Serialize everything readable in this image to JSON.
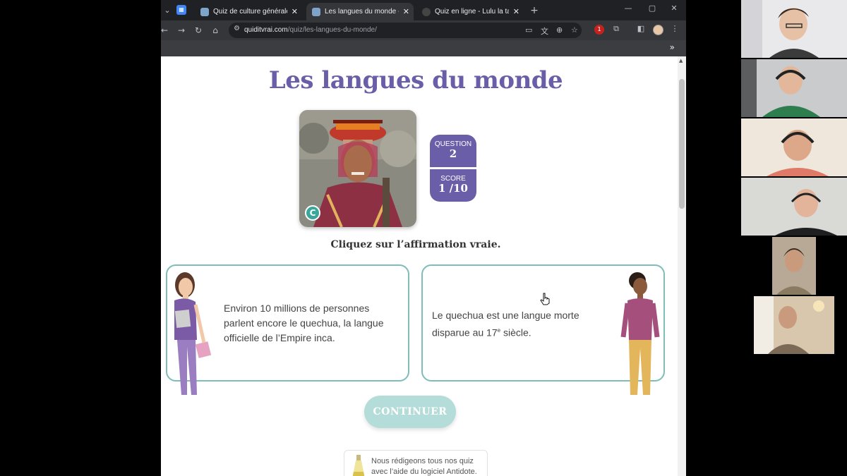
{
  "browser": {
    "tabs": [
      {
        "title": "Quiz de culture générale - Quiz",
        "active": false
      },
      {
        "title": "Les langues du monde - Quiz C",
        "active": true
      },
      {
        "title": "Quiz en ligne - Lulu la taupe, je",
        "active": false
      }
    ],
    "new_tab_symbol": "+",
    "url_domain": "quiditvrai.com",
    "url_path": "/quiz/les-langues-du-monde/",
    "bookmarks_overflow": "»",
    "extension_badge": "1"
  },
  "quiz": {
    "title": "Les langues du monde",
    "photo_badge": "C",
    "question_label": "QUESTION",
    "question_number": "2",
    "score_label": "SCORE",
    "score_value": "1 /10",
    "instruction": "Cliquez sur l’affirmation vraie.",
    "answers": [
      {
        "text": "Environ 10 millions de personnes parlent encore le quechua, la langue officielle de l’Empire inca."
      },
      {
        "text_before": "Le quechua est une langue morte disparue au 17",
        "superscript": "e",
        "text_after": " siècle."
      }
    ],
    "continue_label": "CONTINUER",
    "antidote_text": "Nous rédigeons tous nos quiz avec l’aide du logiciel Antidote."
  },
  "colors": {
    "brand_purple": "#6b5ea8",
    "teal_border": "#7fbdb8",
    "continue_bg": "#b4dcd9",
    "chrome_dark": "#202124"
  },
  "icons": [
    "back-arrow-icon",
    "forward-arrow-icon",
    "reload-icon",
    "home-icon",
    "site-settings-icon",
    "install-icon",
    "translate-icon",
    "zoom-icon",
    "bookmark-star-icon",
    "extensions-icon",
    "side-panel-icon",
    "menu-dots-icon",
    "minimize-icon",
    "maximize-icon",
    "close-icon"
  ]
}
